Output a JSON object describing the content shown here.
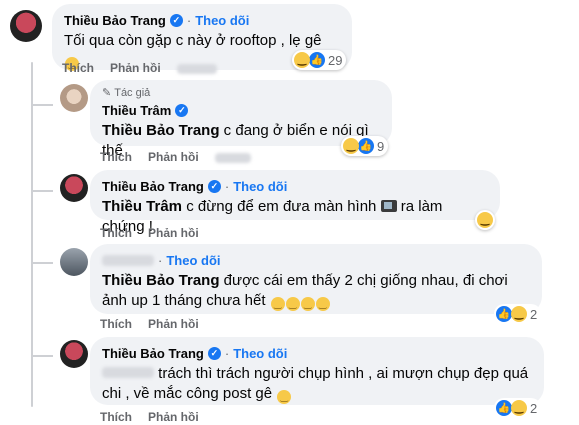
{
  "comments": [
    {
      "author": "Thiều Bảo Trang",
      "follow": "Theo dõi",
      "text": "Tối qua còn gặp c này ở rooftop , lẹ gê",
      "actions": {
        "like": "Thích",
        "reply": "Phản hồi"
      },
      "reaction_count": "29"
    },
    {
      "author_tag": "Tác giả",
      "author": "Thiều Trâm",
      "mention": "Thiều Bảo Trang",
      "text": " c đang ở biển e nói gì thế",
      "actions": {
        "like": "Thích",
        "reply": "Phản hồi"
      },
      "reaction_count": "9"
    },
    {
      "author": "Thiều Bảo Trang",
      "follow": "Theo dõi",
      "mention": "Thiều Trâm",
      "text_before": " c đừng để em đưa màn hình ",
      "text_after": " ra làm chứng !",
      "actions": {
        "like": "Thích",
        "reply": "Phản hồi"
      }
    },
    {
      "follow": "Theo dõi",
      "mention": "Thiều Bảo Trang",
      "text": " được cái em thấy 2 chị giống nhau, đi chơi ảnh up 1 tháng chưa hết",
      "actions": {
        "like": "Thích",
        "reply": "Phản hồi"
      },
      "reaction_count": "2"
    },
    {
      "author": "Thiều Bảo Trang",
      "follow": "Theo dõi",
      "text": "trách thì trách người chụp hình , ai mượn chụp đẹp quá chi , về mắc công post gê",
      "actions": {
        "like": "Thích",
        "reply": "Phản hồi"
      },
      "reaction_count": "2"
    }
  ],
  "colors": {
    "bubble": "#f0f2f5",
    "link": "#1877f2",
    "muted": "#65676b",
    "line": "#ced0d4"
  },
  "icons": [
    "verified-badge-icon",
    "laugh-emoji-icon",
    "like-reaction-icon",
    "tv-emoji-icon",
    "author-edit-icon"
  ]
}
